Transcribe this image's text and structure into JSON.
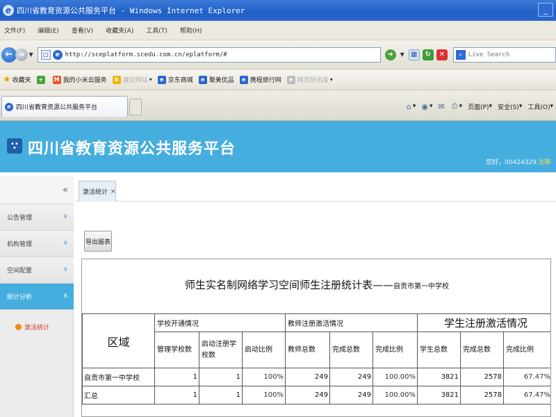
{
  "browser": {
    "window_title": "四川省教育资源公共服务平台 - Windows Internet Explorer",
    "menu": [
      "文件(F)",
      "编辑(E)",
      "查看(V)",
      "收藏夹(A)",
      "工具(T)",
      "帮助(H)"
    ],
    "address_url": "http://sceplatform.scedu.com.cn/eplatform/#",
    "search_placeholder": "Live Search",
    "favorites_label": "收藏夹",
    "favorites": [
      {
        "label": "我的小米云服务",
        "icon": "orange"
      },
      {
        "label": "建议网站",
        "icon": "yellow",
        "dim": true
      },
      {
        "label": "京东商城",
        "icon": "blue"
      },
      {
        "label": "聚美优品",
        "icon": "blue"
      },
      {
        "label": "携程旅行网",
        "icon": "blue"
      },
      {
        "label": "网页快讯库",
        "icon": "grey",
        "dim": true
      }
    ],
    "tab_title": "四川省教育资源公共服务平台",
    "commands": {
      "page": "页面(P)",
      "safety": "安全(S)",
      "tools": "工具(O)"
    }
  },
  "site": {
    "title": "四川省教育资源公共服务平台",
    "user_greeting": "您好，00424329",
    "logout": "注销"
  },
  "sidebar": {
    "collapse_glyph": "«",
    "items": [
      {
        "label": "公告管理",
        "active": false
      },
      {
        "label": "机构管理",
        "active": false
      },
      {
        "label": "空间配置",
        "active": false
      },
      {
        "label": "统计分析",
        "active": true
      }
    ],
    "sub_item": "激活统计"
  },
  "content": {
    "tab_label": "激活统计",
    "export_button": "导出报表",
    "report": {
      "title": "师生实名制网络学习空间师生注册统计表——",
      "subtitle": "自贡市第一中学校",
      "region_header": "区域",
      "groups": [
        "学校开通情况",
        "教师注册激活情况",
        "学生注册激活情况"
      ],
      "subheaders": [
        "管理学校数",
        "启动注册学校数",
        "启动比例",
        "教师总数",
        "完成总数",
        "完成比例",
        "学生总数",
        "完成总数",
        "完成比例"
      ],
      "rows": [
        {
          "name": "自贡市第一中学校",
          "values": [
            "1",
            "1",
            "100%",
            "249",
            "249",
            "100.00%",
            "3821",
            "2578",
            "67.47%"
          ]
        },
        {
          "name": "汇总",
          "values": [
            "1",
            "1",
            "100%",
            "249",
            "249",
            "100.00%",
            "3821",
            "2578",
            "67.47%"
          ]
        }
      ]
    }
  }
}
